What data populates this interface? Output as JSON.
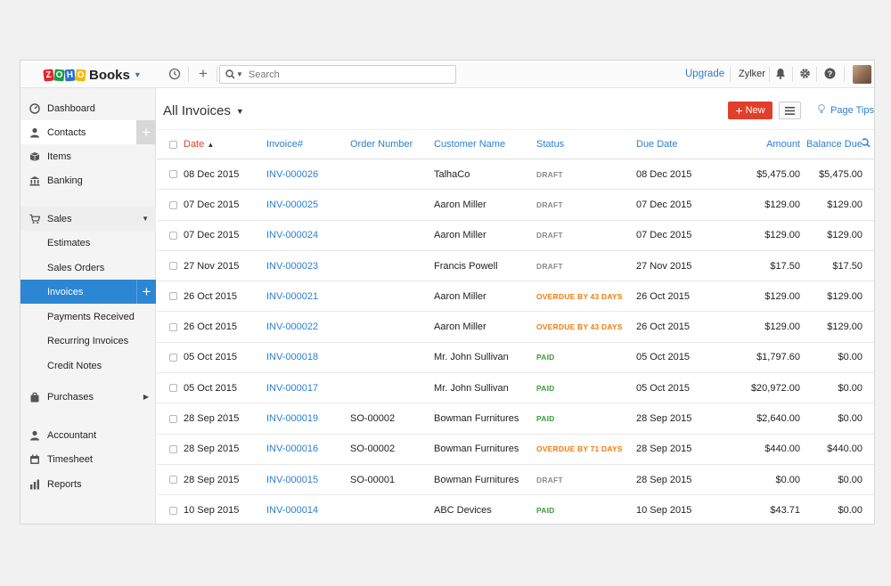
{
  "app": {
    "logo_letters": [
      "Z",
      "O",
      "H",
      "O"
    ],
    "product_name": "Books"
  },
  "topbar": {
    "search_placeholder": "Search",
    "upgrade_label": "Upgrade",
    "org_name": "Zylker"
  },
  "sidebar": {
    "items": [
      {
        "label": "Dashboard",
        "icon": "dashboard-icon"
      },
      {
        "label": "Contacts",
        "icon": "contacts-icon"
      },
      {
        "label": "Items",
        "icon": "items-icon"
      },
      {
        "label": "Banking",
        "icon": "banking-icon"
      }
    ],
    "sales": {
      "label": "Sales",
      "subitems": [
        "Estimates",
        "Sales Orders",
        "Invoices",
        "Payments Received",
        "Recurring Invoices",
        "Credit Notes"
      ]
    },
    "purchases_label": "Purchases",
    "bottom_items": [
      {
        "label": "Accountant",
        "icon": "accountant-icon"
      },
      {
        "label": "Timesheet",
        "icon": "timesheet-icon"
      },
      {
        "label": "Reports",
        "icon": "reports-icon"
      }
    ]
  },
  "main": {
    "title": "All Invoices",
    "new_label": "New",
    "page_tips_label": "Page Tips",
    "columns": [
      "Date",
      "Invoice#",
      "Order Number",
      "Customer Name",
      "Status",
      "Due Date",
      "Amount",
      "Balance Due"
    ],
    "rows": [
      {
        "date": "08 Dec 2015",
        "invoice": "INV-000026",
        "order": "",
        "customer": "TalhaCo",
        "status": "DRAFT",
        "status_type": "draft",
        "due": "08 Dec 2015",
        "amount": "$5,475.00",
        "balance": "$5,475.00"
      },
      {
        "date": "07 Dec 2015",
        "invoice": "INV-000025",
        "order": "",
        "customer": "Aaron Miller",
        "status": "DRAFT",
        "status_type": "draft",
        "due": "07 Dec 2015",
        "amount": "$129.00",
        "balance": "$129.00"
      },
      {
        "date": "07 Dec 2015",
        "invoice": "INV-000024",
        "order": "",
        "customer": "Aaron Miller",
        "status": "DRAFT",
        "status_type": "draft",
        "due": "07 Dec 2015",
        "amount": "$129.00",
        "balance": "$129.00"
      },
      {
        "date": "27 Nov 2015",
        "invoice": "INV-000023",
        "order": "",
        "customer": "Francis Powell",
        "status": "DRAFT",
        "status_type": "draft",
        "due": "27 Nov 2015",
        "amount": "$17.50",
        "balance": "$17.50"
      },
      {
        "date": "26 Oct 2015",
        "invoice": "INV-000021",
        "order": "",
        "customer": "Aaron Miller",
        "status": "OVERDUE BY 43 DAYS",
        "status_type": "overdue",
        "due": "26 Oct 2015",
        "amount": "$129.00",
        "balance": "$129.00"
      },
      {
        "date": "26 Oct 2015",
        "invoice": "INV-000022",
        "order": "",
        "customer": "Aaron Miller",
        "status": "OVERDUE BY 43 DAYS",
        "status_type": "overdue",
        "due": "26 Oct 2015",
        "amount": "$129.00",
        "balance": "$129.00"
      },
      {
        "date": "05 Oct 2015",
        "invoice": "INV-000018",
        "order": "",
        "customer": "Mr. John Sullivan",
        "status": "PAID",
        "status_type": "paid",
        "due": "05 Oct 2015",
        "amount": "$1,797.60",
        "balance": "$0.00"
      },
      {
        "date": "05 Oct 2015",
        "invoice": "INV-000017",
        "order": "",
        "customer": "Mr. John Sullivan",
        "status": "PAID",
        "status_type": "paid",
        "due": "05 Oct 2015",
        "amount": "$20,972.00",
        "balance": "$0.00"
      },
      {
        "date": "28 Sep 2015",
        "invoice": "INV-000019",
        "order": "SO-00002",
        "customer": "Bowman Furnitures",
        "status": "PAID",
        "status_type": "paid",
        "due": "28 Sep 2015",
        "amount": "$2,640.00",
        "balance": "$0.00"
      },
      {
        "date": "28 Sep 2015",
        "invoice": "INV-000016",
        "order": "SO-00002",
        "customer": "Bowman Furnitures",
        "status": "OVERDUE BY 71 DAYS",
        "status_type": "overdue",
        "due": "28 Sep 2015",
        "amount": "$440.00",
        "balance": "$440.00"
      },
      {
        "date": "28 Sep 2015",
        "invoice": "INV-000015",
        "order": "SO-00001",
        "customer": "Bowman Furnitures",
        "status": "DRAFT",
        "status_type": "draft",
        "due": "28 Sep 2015",
        "amount": "$0.00",
        "balance": "$0.00"
      },
      {
        "date": "10 Sep 2015",
        "invoice": "INV-000014",
        "order": "",
        "customer": "ABC Devices",
        "status": "PAID",
        "status_type": "paid",
        "due": "10 Sep 2015",
        "amount": "$43.71",
        "balance": "$0.00"
      }
    ]
  },
  "colors": {
    "accent": "#2a7fd0",
    "active_nav": "#2b86d3",
    "new_button": "#e0402a",
    "paid": "#3c9d3c",
    "overdue": "#f07b10",
    "draft": "#8a8a8a"
  }
}
